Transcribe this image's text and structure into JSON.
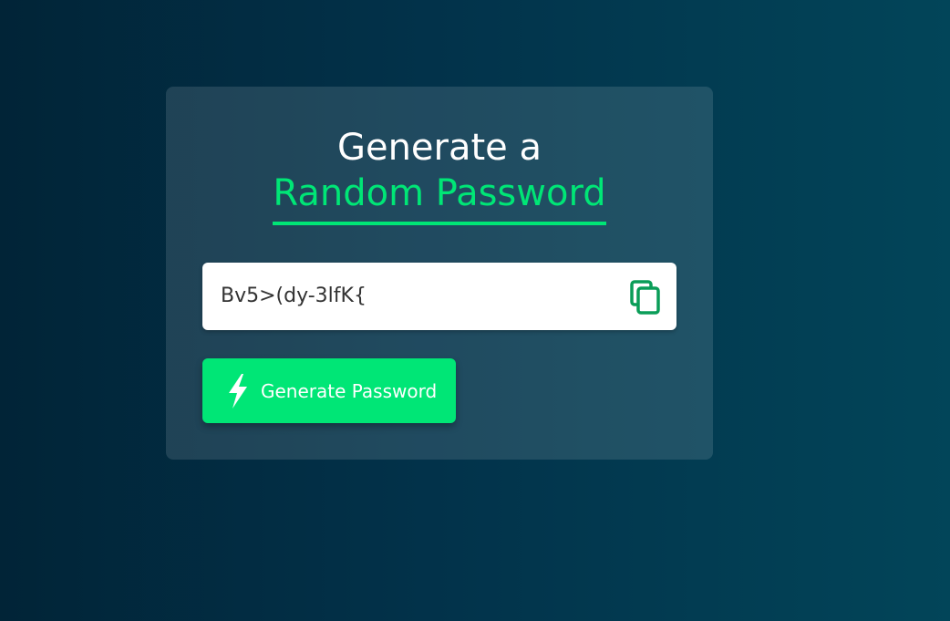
{
  "title": {
    "line1": "Generate a",
    "line2": "Random Password"
  },
  "password": {
    "value": "Bv5>(dy-3lfK{",
    "copy_icon": "copy-icon"
  },
  "generate_button": {
    "label": "Generate Password",
    "icon": "lightning-bolt-icon"
  },
  "colors": {
    "accent": "#00e676",
    "copy_icon": "#0a9d58",
    "background_start": "#012437",
    "background_end": "#024559"
  }
}
